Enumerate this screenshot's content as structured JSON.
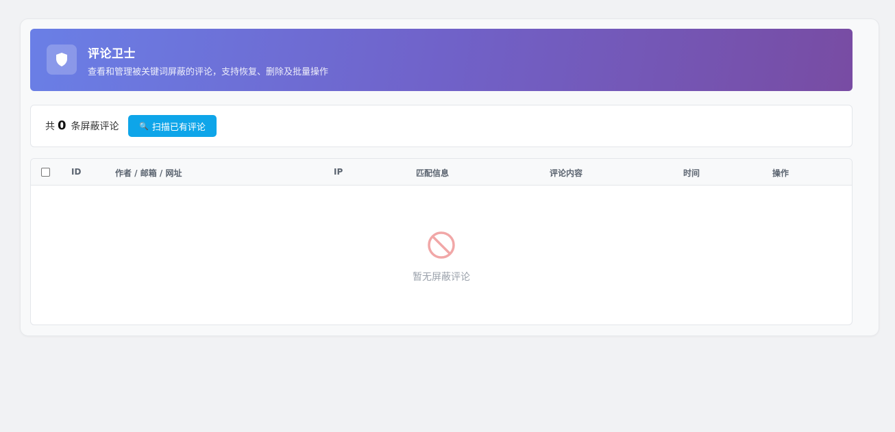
{
  "header": {
    "title": "评论卫士",
    "subtitle": "查看和管理被关键词屏蔽的评论，支持恢复、删除及批量操作",
    "icon": "shield-icon"
  },
  "toolbar": {
    "count_prefix": "共",
    "count": "0",
    "count_suffix": "条屏蔽评论",
    "scan_label": "扫描已有评论",
    "scan_icon": "🔍"
  },
  "table": {
    "columns": [
      "ID",
      "作者 / 邮箱 / 网址",
      "IP",
      "匹配信息",
      "评论内容",
      "时间",
      "操作"
    ],
    "rows": []
  },
  "empty": {
    "text": "暂无屏蔽评论",
    "icon": "prohibited-icon"
  },
  "colors": {
    "gradient_start": "#6a7fe6",
    "gradient_end": "#784ca3",
    "button": "#0ea5e9",
    "empty_icon": "#f1a7a7"
  }
}
